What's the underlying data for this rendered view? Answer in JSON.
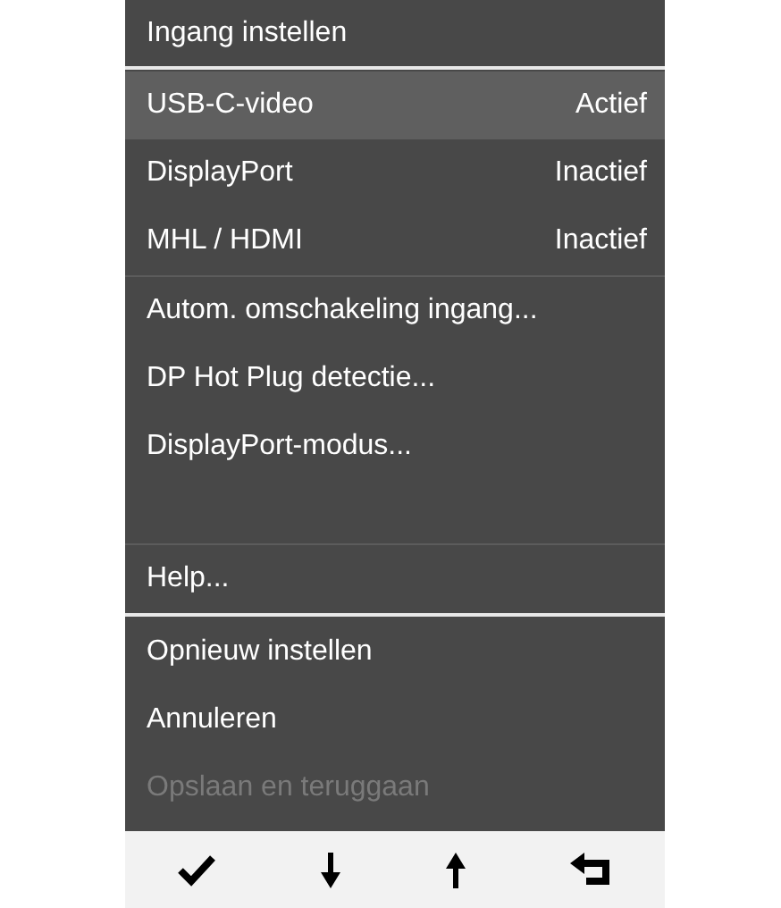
{
  "title": "Ingang instellen",
  "inputs": [
    {
      "label": "USB-C-video",
      "status": "Actief",
      "selected": true
    },
    {
      "label": "DisplayPort",
      "status": "Inactief",
      "selected": false
    },
    {
      "label": "MHL / HDMI",
      "status": "Inactief",
      "selected": false
    }
  ],
  "options": [
    {
      "label": "Autom. omschakeling ingang..."
    },
    {
      "label": "DP Hot Plug detectie..."
    },
    {
      "label": "DisplayPort-modus..."
    }
  ],
  "help": {
    "label": "Help..."
  },
  "actions": [
    {
      "label": "Opnieuw instellen",
      "disabled": false
    },
    {
      "label": "Annuleren",
      "disabled": false
    },
    {
      "label": "Opslaan en teruggaan",
      "disabled": true
    }
  ],
  "toolbar": [
    {
      "kind": "confirm"
    },
    {
      "kind": "down"
    },
    {
      "kind": "up"
    },
    {
      "kind": "back"
    }
  ]
}
